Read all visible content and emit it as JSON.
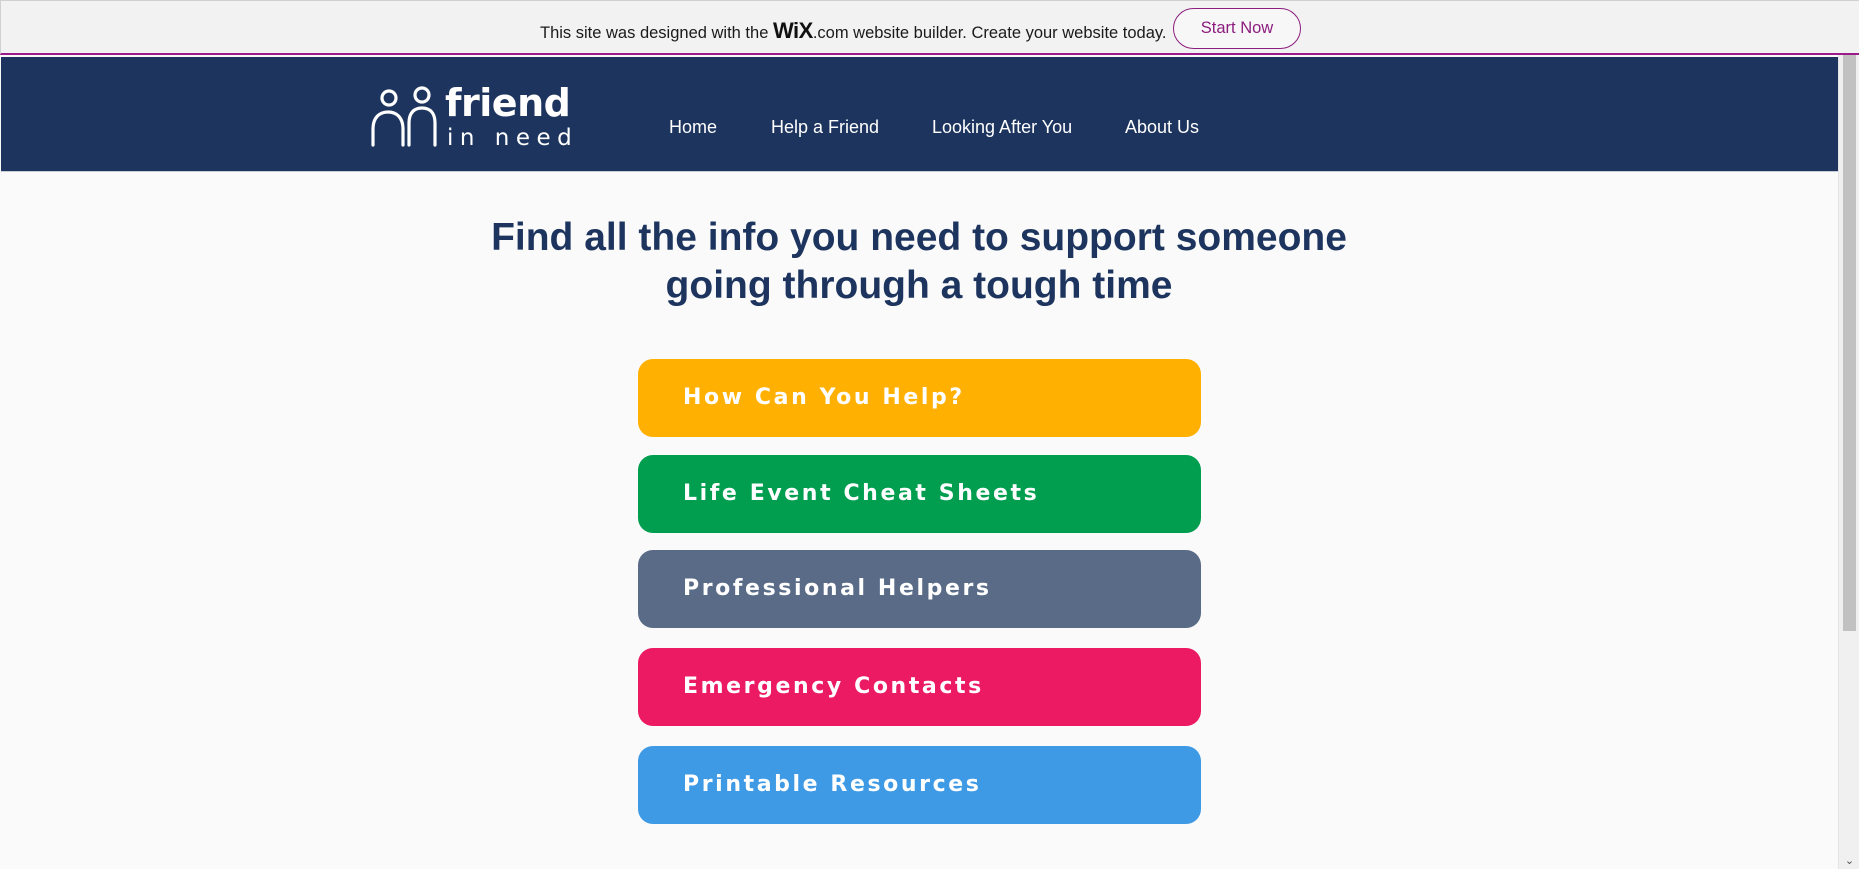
{
  "wix_banner": {
    "text_before": "This site was designed with the ",
    "wix_logo": "WiX",
    "text_after": ".com website builder. Create your website today.",
    "button_label": "Start Now",
    "accent_color": "#8c1d7e"
  },
  "header": {
    "logo": {
      "word": "friend",
      "sub": "in need",
      "icon": "two-people-icon"
    },
    "nav": [
      {
        "label": "Home"
      },
      {
        "label": "Help a Friend"
      },
      {
        "label": "Looking After You"
      },
      {
        "label": "About Us"
      }
    ],
    "background_color": "#1d355e"
  },
  "main": {
    "headline_line1": "Find all the info you need to support someone",
    "headline_line2": "going through a tough time",
    "buttons": [
      {
        "label": "How Can You Help?",
        "color": "#ffb000"
      },
      {
        "label": "Life Event Cheat Sheets",
        "color": "#009e4e"
      },
      {
        "label": "Professional Helpers",
        "color": "#596b87"
      },
      {
        "label": "Emergency Contacts",
        "color": "#ec1a63"
      },
      {
        "label": "Printable Resources",
        "color": "#3f9ae6"
      }
    ]
  },
  "scrollbar": {
    "up_icon": "chevron-up-icon",
    "down_icon": "chevron-down-icon"
  }
}
